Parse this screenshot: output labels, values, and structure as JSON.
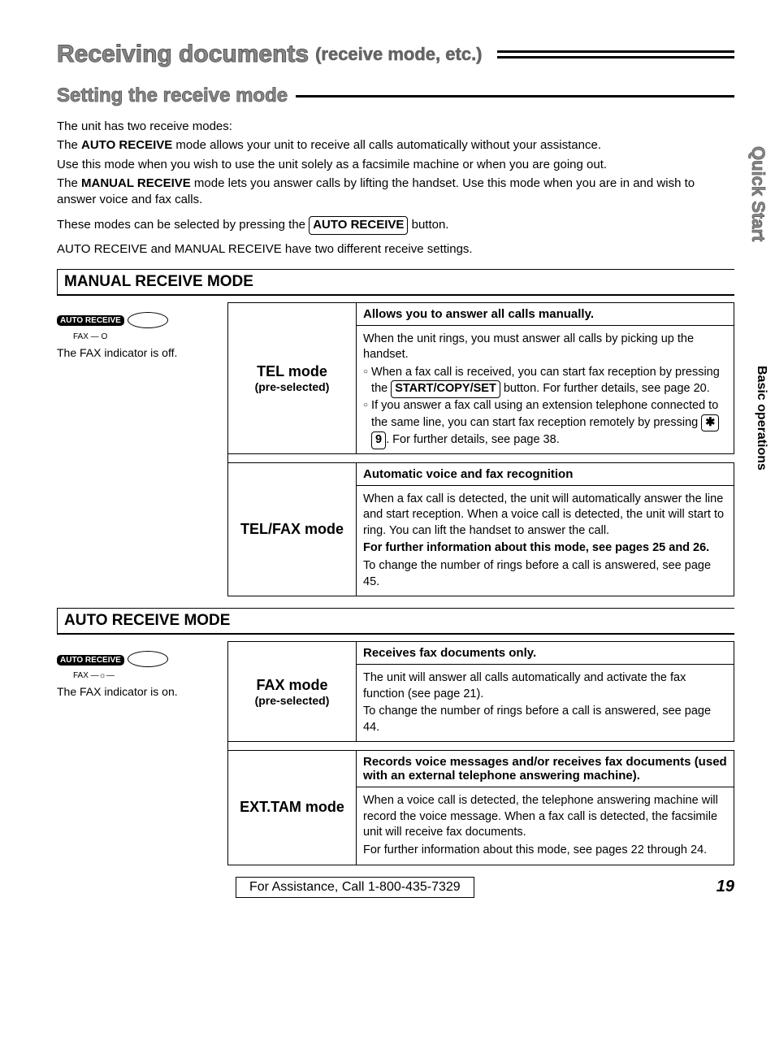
{
  "title_main": "Receiving documents",
  "title_paren": "(receive mode, etc.)",
  "subtitle": "Setting the receive mode",
  "intro": {
    "line1": "The unit has two receive modes:",
    "line2a": "The ",
    "line2b": "AUTO RECEIVE",
    "line2c": " mode allows your unit to receive all calls automatically without your assistance.",
    "line3": "Use this mode when you wish to use the unit solely as a facsimile machine or when you are going out.",
    "line4a": "The ",
    "line4b": "MANUAL RECEIVE",
    "line4c": " mode lets you answer calls by lifting the handset. Use this mode when you are in and wish to answer voice and fax calls.",
    "line5a": "These modes can be selected by pressing the ",
    "line5btn": "AUTO RECEIVE",
    "line5b": " button.",
    "line6": "AUTO RECEIVE and MANUAL RECEIVE have two different receive settings."
  },
  "sections": {
    "manual": {
      "header": "MANUAL RECEIVE MODE",
      "indicator_label": "AUTO RECEIVE",
      "fax_label": "FAX — O",
      "indicator_text": "The FAX indicator is off.",
      "modes": [
        {
          "name": "TEL mode",
          "pre": "(pre-selected)",
          "head": "Allows you to answer all calls manually.",
          "body1": "When the unit rings, you must answer all calls by picking up the handset.",
          "bullet1a": "When a fax call is received, you can start fax reception by pressing the ",
          "bullet1btn": "START/COPY/SET",
          "bullet1b": " button. For further details, see page 20.",
          "bullet2a": "If you answer a fax call using an extension telephone connected to the same line, you can start fax reception remotely by pressing ",
          "bullet2key1": "✱",
          "bullet2key2": "9",
          "bullet2b": ". For further details, see page 38."
        },
        {
          "name": "TEL/FAX mode",
          "pre": "",
          "head": "Automatic voice and fax recognition",
          "body1": "When a fax call is detected, the unit will automatically answer the line and start reception. When a voice call is detected, the unit will start to ring. You can lift the handset to answer the call.",
          "body2": "For further information about this mode, see pages 25 and 26.",
          "body3": "To change the number of rings before a call is answered, see page 45."
        }
      ]
    },
    "auto": {
      "header": "AUTO RECEIVE MODE",
      "indicator_label": "AUTO RECEIVE",
      "fax_label": "FAX —☼—",
      "indicator_text": "The FAX indicator is on.",
      "modes": [
        {
          "name": "FAX mode",
          "pre": "(pre-selected)",
          "head": "Receives fax documents only.",
          "body1": "The unit will answer all calls automatically and activate the fax function (see page 21).",
          "body2": "To change the number of rings before a call is answered, see page 44."
        },
        {
          "name": "EXT.TAM mode",
          "pre": "",
          "head": "Records voice messages and/or receives fax documents (used with an external telephone answering machine).",
          "body1": "When a voice call is detected, the telephone answering machine will record the voice message. When a fax call is detected, the facsimile unit will receive fax documents.",
          "body2": "For further information about this mode, see pages 22 through 24."
        }
      ]
    }
  },
  "side": {
    "qs": "Quick Start",
    "bo": "Basic operations"
  },
  "footer": {
    "assist": "For Assistance, Call 1-800-435-7329",
    "page": "19"
  }
}
